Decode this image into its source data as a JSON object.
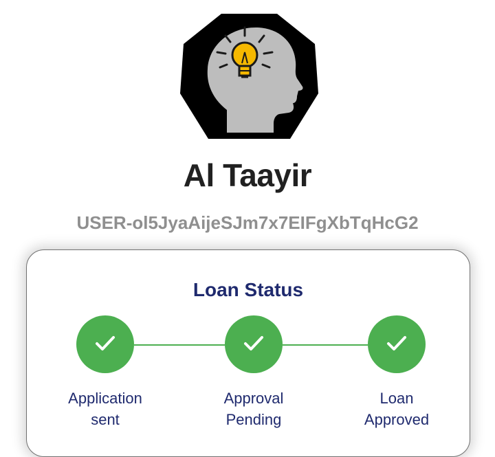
{
  "app": {
    "name": "Al Taayir",
    "user_id": "USER-ol5JyaAijeSJm7x7EIFgXbTqHcG2",
    "logo_icon": "head-lightbulb-logo-icon"
  },
  "loan_status": {
    "title": "Loan Status",
    "accent_color": "#4caf50",
    "text_color": "#1f2a6e",
    "steps": [
      {
        "label": "Application\nsent",
        "icon": "check-icon",
        "completed": true
      },
      {
        "label": "Approval\nPending",
        "icon": "check-icon",
        "completed": true
      },
      {
        "label": "Loan\nApproved",
        "icon": "check-icon",
        "completed": true
      }
    ]
  }
}
